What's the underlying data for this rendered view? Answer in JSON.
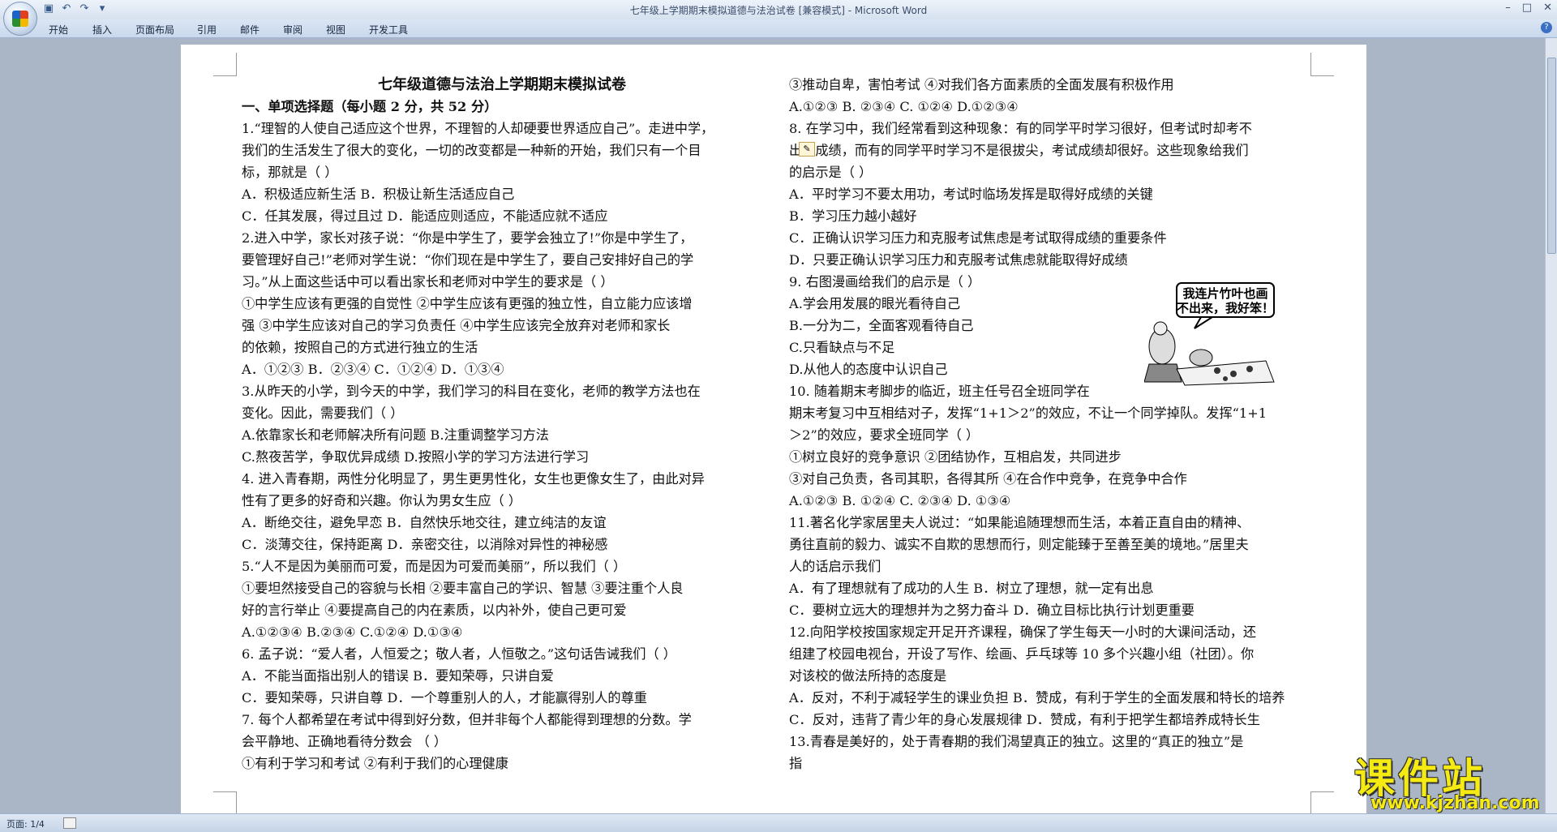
{
  "window": {
    "title": "七年级上学期期末模拟道德与法治试卷 [兼容模式] - Microsoft Word",
    "controls": [
      "–",
      "□",
      "✕"
    ]
  },
  "ribbon": {
    "tabs": [
      "开始",
      "插入",
      "页面布局",
      "引用",
      "邮件",
      "审阅",
      "视图",
      "开发工具"
    ],
    "help": "?"
  },
  "qat": {
    "save_icon": "save-icon",
    "undo_icon": "undo-icon",
    "redo_icon": "redo-icon"
  },
  "document": {
    "left_lines": [
      {
        "text": "七年级道德与法治上学期期末模拟试卷",
        "style": "title"
      },
      {
        "text": "一、单项选择题（每小题 2 分，共 52 分）",
        "style": "bold"
      },
      {
        "text": "1.“理智的人使自己适应这个世界，不理智的人却硬要世界适应自己”。走进中学，"
      },
      {
        "text": "我们的生活发生了很大的变化，一切的改变都是一种新的开始，我们只有一个目"
      },
      {
        "text": "标，那就是（     ）"
      },
      {
        "text": "A．积极适应新生活                                 B．积极让新生活适应自己"
      },
      {
        "text": "C．任其发展，得过且过                             D．能适应则适应，不能适应就不适应"
      },
      {
        "text": "2.进入中学，家长对孩子说：“你是中学生了，要学会独立了!”你是中学生了，"
      },
      {
        "text": "要管理好自己!”老师对学生说：“你们现在是中学生了，要自己安排好自己的学"
      },
      {
        "text": "习。”从上面这些话中可以看出家长和老师对中学生的要求是（     ）"
      },
      {
        "text": "①中学生应该有更强的自觉性    ②中学生应该有更强的独立性，自立能力应该增"
      },
      {
        "text": "强     ③中学生应该对自己的学习负责任     ④中学生应该完全放弃对老师和家长"
      },
      {
        "text": "的依赖，按照自己的方式进行独立的生活"
      },
      {
        "text": "A．①②③          B．②③④          C．①②④          D．①③④"
      },
      {
        "text": "3.从昨天的小学，到今天的中学，我们学习的科目在变化，老师的教学方法也在"
      },
      {
        "text": "变化。因此，需要我们（    ）"
      },
      {
        "text": "A.依靠家长和老师解决所有问题                 B.注重调整学习方法"
      },
      {
        "text": "C.熬夜苦学，争取优异成绩                     D.按照小学的学习方法进行学习"
      },
      {
        "text": "4. 进入青春期，两性分化明显了，男生更男性化，女生也更像女生了，由此对异"
      },
      {
        "text": "性有了更多的好奇和兴趣。你认为男女生应（     ）"
      },
      {
        "text": "A．断绝交往，避免早恋         B．自然快乐地交往，建立纯洁的友谊"
      },
      {
        "text": "C．淡薄交往，保持距离         D．亲密交往，以消除对异性的神秘感"
      },
      {
        "text": "5.“人不是因为美丽而可爱，而是因为可爱而美丽”，所以我们（     ）"
      },
      {
        "text": "①要坦然接受自己的容貌与长相    ②要丰富自己的学识、智慧    ③要注重个人良"
      },
      {
        "text": "好的言行举止      ④要提高自己的内在素质，以内补外，使自己更可爱"
      },
      {
        "text": "A.①②③④                    B.②③④                    C.①②④                    D.①③④"
      },
      {
        "text": "6. 孟子说：“爱人者，人恒爱之；敬人者，人恒敬之。”这句话告诫我们（     ）"
      },
      {
        "text": "A．不能当面指出别人的错误            B．要知荣辱，只讲自爱"
      },
      {
        "text": "C．要知荣辱，只讲自尊                D．一个尊重别人的人，才能赢得别人的尊重"
      },
      {
        "text": "7.    每个人都希望在考试中得到好分数，但并非每个人都能得到理想的分数。学"
      },
      {
        "text": "会平静地、正确地看待分数会  （     ）"
      },
      {
        "text": "①有利于学习和考试           ②有利于我们的心理健康"
      }
    ],
    "right_lines": [
      {
        "text": "③推动自卑，害怕考试        ④对我们各方面素质的全面发展有积极作用"
      },
      {
        "text": "A.①②③       B. ②③④      C. ①②④       D.①②③④"
      },
      {
        "text": "8. 在学习中，我们经常看到这种现象：有的同学平时学习很好，但考试时却考不"
      },
      {
        "text": "出好成绩，而有的同学平时学习不是很拔尖，考试成绩却很好。这些现象给我们"
      },
      {
        "text": "的启示是（     ）"
      },
      {
        "text": "A．平时学习不要太用功，考试时临场发挥是取得好成绩的关键"
      },
      {
        "text": "B．学习压力越小越好"
      },
      {
        "text": "C．正确认识学习压力和克服考试焦虑是考试取得成绩的重要条件"
      },
      {
        "text": "D．只要正确认识学习压力和克服考试焦虑就能取得好成绩"
      },
      {
        "text": "9. 右图漫画给我们的启示是（     ）"
      },
      {
        "text": "A.学会用发展的眼光看待自己"
      },
      {
        "text": "B.一分为二，全面客观看待自己"
      },
      {
        "text": "C.只看缺点与不足"
      },
      {
        "text": "D.从他人的态度中认识自己"
      },
      {
        "text": "10.  随着期末考脚步的临近，班主任号召全班同学在"
      },
      {
        "text": "期末考复习中互相结对子，发挥“1+1＞2”的效应，不让一个同学掉队。发挥“1+1"
      },
      {
        "text": "＞2”的效应，要求全班同学（     ）"
      },
      {
        "text": "①树立良好的竞争意识                    ②团结协作，互相启发，共同进步"
      },
      {
        "text": "③对自己负责，各司其职，各得其所          ④在合作中竞争，在竞争中合作"
      },
      {
        "text": "A.①②③          B. ①②④          C. ②③④          D. ①③④"
      },
      {
        "text": "11.著名化学家居里夫人说过：“如果能追随理想而生活，本着正直自由的精神、"
      },
      {
        "text": "勇往直前的毅力、诚实不自欺的思想而行，则定能臻于至善至美的境地。”居里夫"
      },
      {
        "text": "人的话启示我们"
      },
      {
        "text": "A．有了理想就有了成功的人生                   B．树立了理想，就一定有出息"
      },
      {
        "text": "C．要树立远大的理想并为之努力奋斗             D．确立目标比执行计划更重要"
      },
      {
        "text": "12.向阳学校按国家规定开足开齐课程，确保了学生每天一小时的大课间活动，还"
      },
      {
        "text": "组建了校园电视台，开设了写作、绘画、乒乓球等 10 多个兴趣小组（社团）。你"
      },
      {
        "text": "对该校的做法所持的态度是"
      },
      {
        "text": "A．反对，不利于减轻学生的课业负担 B．赞成，有利于学生的全面发展和特长的培养"
      },
      {
        "text": "C．反对，违背了青少年的身心发展规律  D．赞成，有利于把学生都培养成特长生"
      },
      {
        "text": "13.青春是美好的，处于青春期的我们渴望真正的独立。这里的“真正的独立”是"
      },
      {
        "text": "指"
      }
    ],
    "cartoon_caption_1": "我连片竹叶也画",
    "cartoon_caption_2": "不出来，我好笨！"
  },
  "watermark": {
    "main": "课件站",
    "url": "www.kjzhan.com"
  },
  "status": {
    "page": "页面: 1/4"
  }
}
